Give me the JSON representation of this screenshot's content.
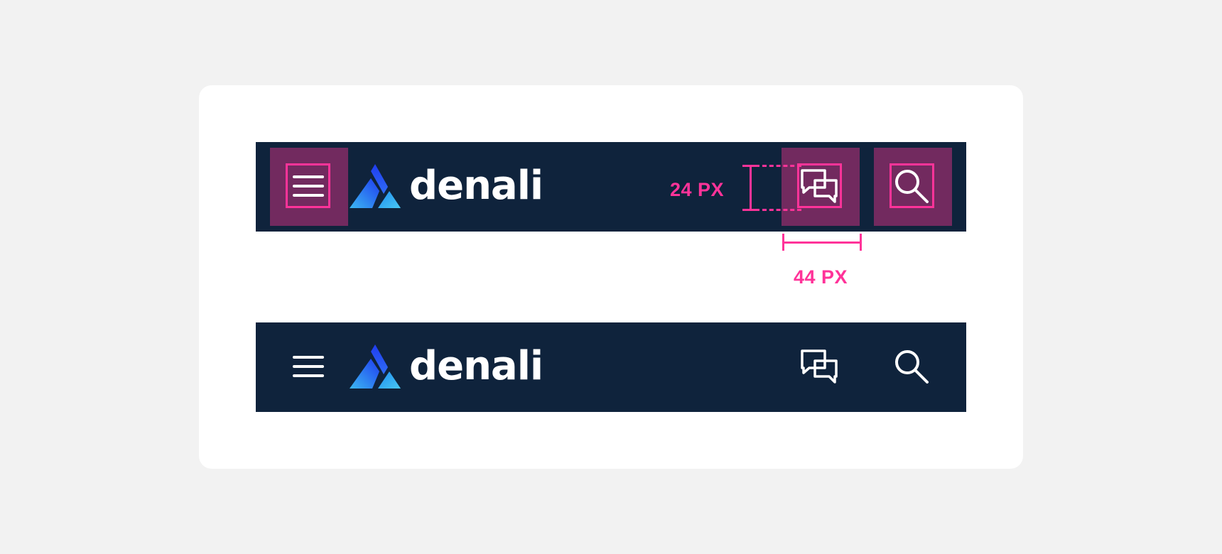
{
  "brand": {
    "name": "denali"
  },
  "icons": {
    "menu": "hamburger-menu-icon",
    "chat": "chat-bubbles-icon",
    "search": "search-icon",
    "logo": "mountain-logo-icon"
  },
  "annotations": {
    "icon_size_label": "24 PX",
    "tap_target_label": "44 PX"
  },
  "colors": {
    "page_bg": "#f2f2f2",
    "card_bg": "#ffffff",
    "header_bg": "#0f233c",
    "tap_target_fill": "#722a5f",
    "annotation": "#ff3399",
    "logo_blue_light": "#3bb8f2",
    "logo_blue_dark": "#1f3cf0"
  }
}
